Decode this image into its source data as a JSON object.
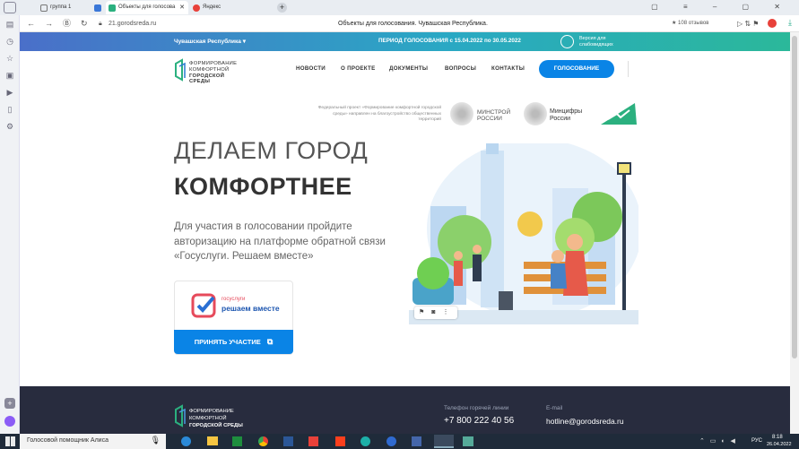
{
  "browser": {
    "tabs": [
      {
        "label": "группа 1"
      },
      {
        "label": "Объекты для голосова"
      },
      {
        "label": "Яндекс"
      }
    ],
    "page_title": "Объекты для голосования. Чувашская Республика.",
    "url": "21.gorodsreda.ru",
    "reviews": "★ 108 отзывов"
  },
  "site": {
    "region": "Чувашская Республика",
    "voting_period": "ПЕРИОД ГОЛОСОВАНИЯ  с 15.04.2022 по 30.05.2022",
    "accessible_version": "Версия для слабовидящих",
    "logo_line1": "ФОРМИРОВАНИЕ",
    "logo_line2": "КОМФОРТНОЙ",
    "logo_line3": "ГОРОДСКОЙ СРЕДЫ",
    "nav": [
      "НОВОСТИ",
      "О ПРОЕКТЕ",
      "ДОКУМЕНТЫ",
      "ВОПРОСЫ",
      "КОНТАКТЫ"
    ],
    "vote_button": "ГОЛОСОВАНИЕ",
    "federal_text": "Федеральный проект «Формирование комфортной городской среды» направлен на благоустройство общественных территорий",
    "minstroy": "МИНСТРОЙ РОССИИ",
    "mincifry": "Минцифры России",
    "hero_line1": "ДЕЛАЕМ ГОРОД",
    "hero_line2": "КОМФОРТНЕЕ",
    "hero_desc": "Для участия в голосовании пройдите авторизацию на платформе обратной связи «Госуслуги. Решаем вместе»",
    "gos_small": "госуслуги",
    "gos_big": "решаем вместе",
    "participate_button": "ПРИНЯТЬ УЧАСТИЕ",
    "hotline_label": "Телефон горячей линии",
    "hotline": "+7 800 222 40 56",
    "email_label": "E-mail",
    "email": "hotline@gorodsreda.ru"
  },
  "taskbar": {
    "assistant": "Голосовой помощник Алиса",
    "lang": "РУС",
    "time": "8:18",
    "date": "26.04.2022"
  },
  "colors": {
    "accent": "#0a84e6",
    "footer": "#282c3e"
  }
}
